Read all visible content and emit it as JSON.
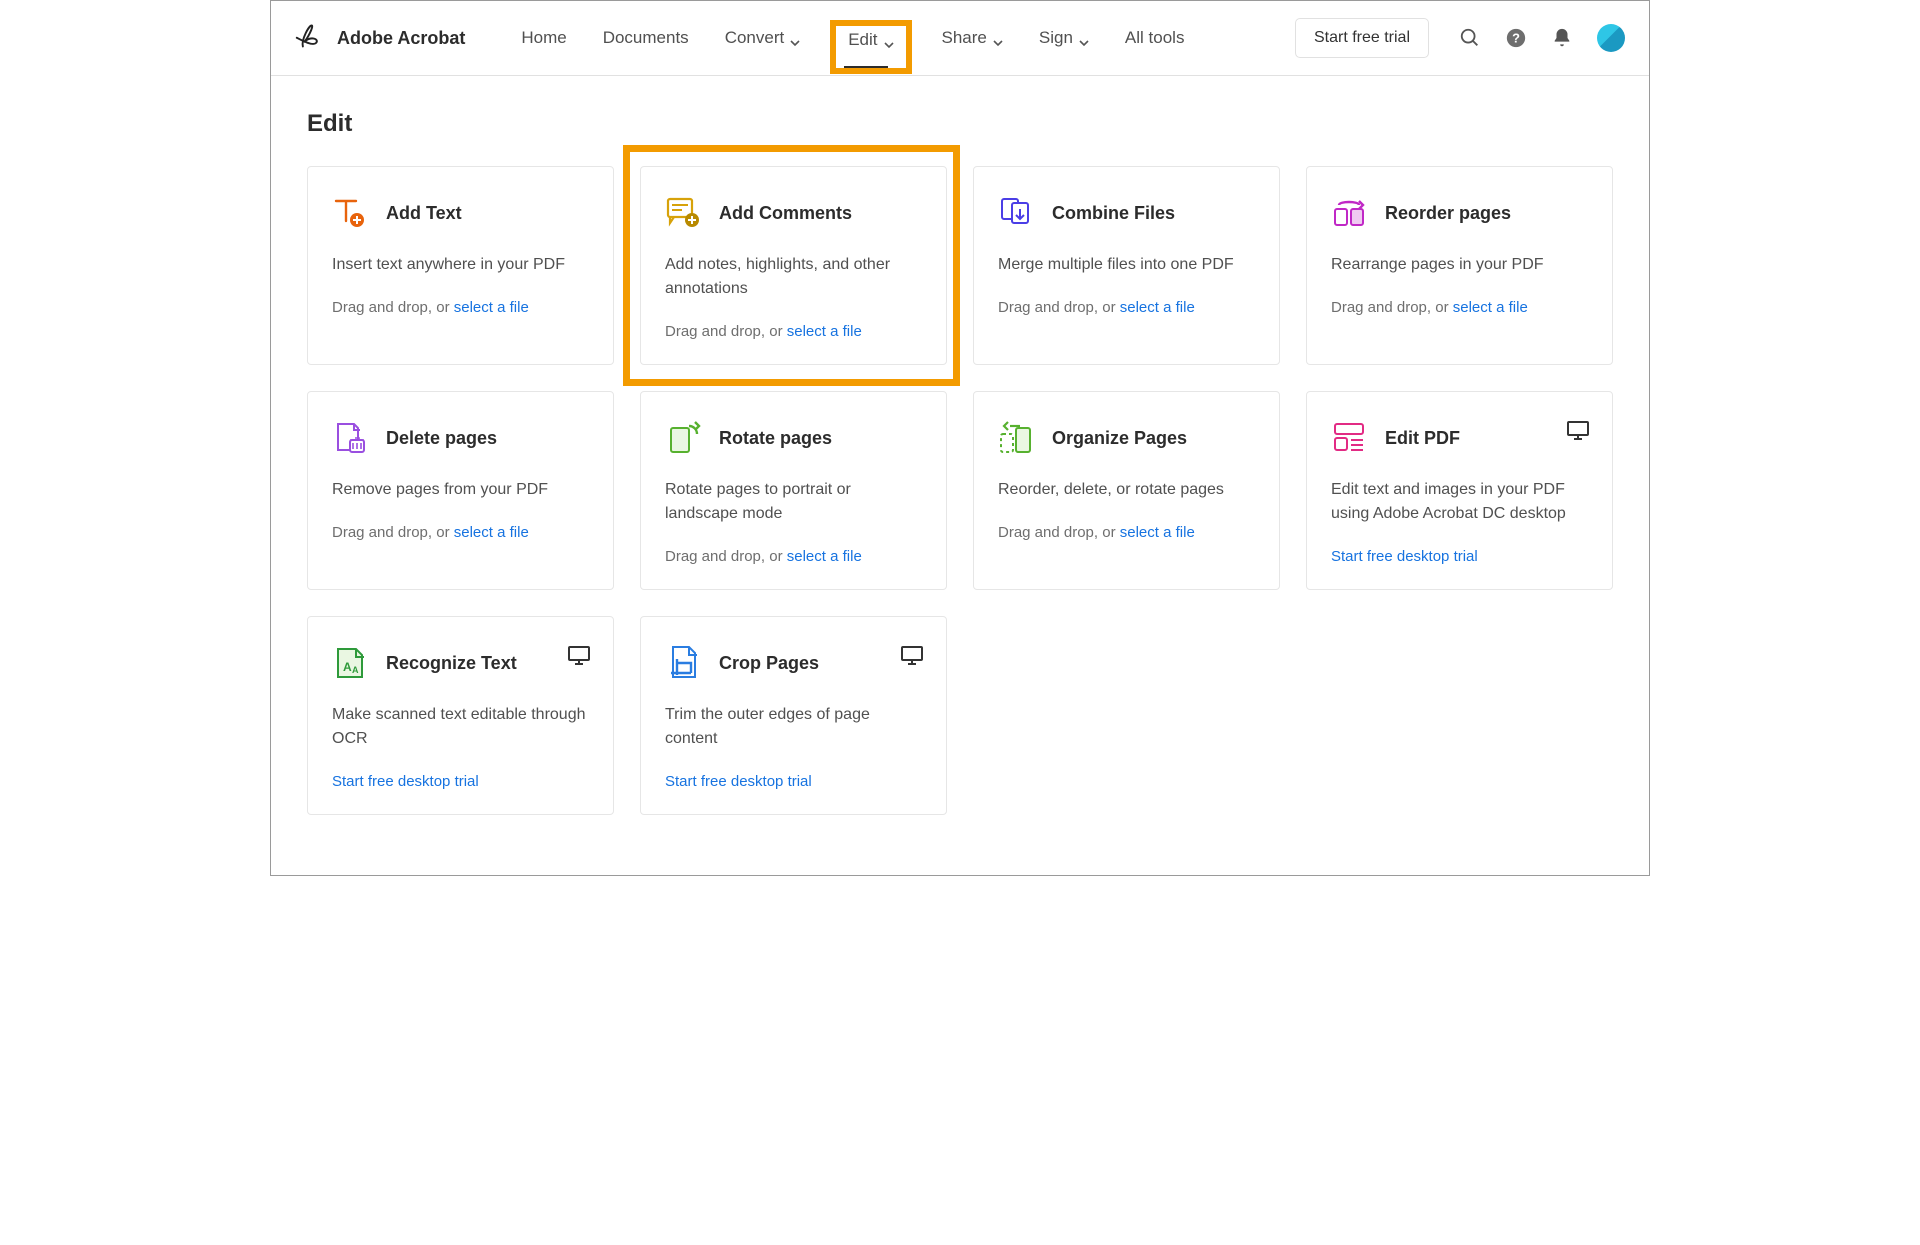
{
  "brand": "Adobe Acrobat",
  "nav": {
    "home": "Home",
    "documents": "Documents",
    "convert": "Convert",
    "edit": "Edit",
    "share": "Share",
    "sign": "Sign",
    "alltools": "All tools"
  },
  "cta": "Start free trial",
  "page_title": "Edit",
  "common": {
    "drag_prefix": "Drag and drop, or ",
    "select_file": "select a file",
    "desktop_trial": "Start free desktop trial"
  },
  "cards": {
    "add_text": {
      "title": "Add Text",
      "desc": "Insert text anywhere in your PDF"
    },
    "add_comments": {
      "title": "Add Comments",
      "desc": "Add notes, highlights, and other annotations"
    },
    "combine": {
      "title": "Combine Files",
      "desc": "Merge multiple files into one PDF"
    },
    "reorder": {
      "title": "Reorder pages",
      "desc": "Rearrange pages in your PDF"
    },
    "delete": {
      "title": "Delete pages",
      "desc": "Remove pages from your PDF"
    },
    "rotate": {
      "title": "Rotate pages",
      "desc": "Rotate pages to portrait or landscape mode"
    },
    "organize": {
      "title": "Organize Pages",
      "desc": "Reorder, delete, or rotate pages"
    },
    "editpdf": {
      "title": "Edit PDF",
      "desc": "Edit text and images in your PDF using Adobe Acrobat DC desktop"
    },
    "recognize": {
      "title": "Recognize Text",
      "desc": "Make scanned text editable through OCR"
    },
    "crop": {
      "title": "Crop Pages",
      "desc": "Trim the outer edges of page content"
    }
  }
}
